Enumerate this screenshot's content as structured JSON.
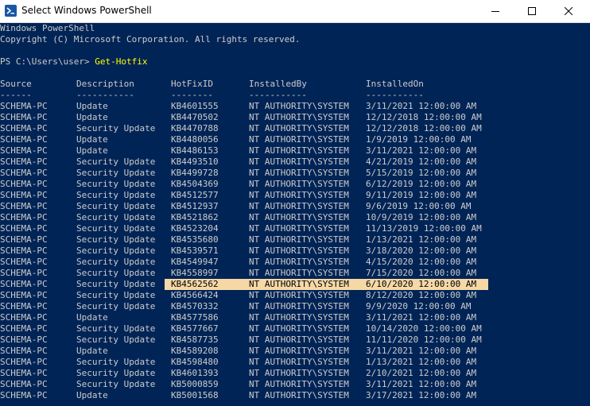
{
  "window": {
    "title": "Select Windows PowerShell"
  },
  "banner": {
    "line1": "Windows PowerShell",
    "line2": "Copyright (C) Microsoft Corporation. All rights reserved."
  },
  "prompt": {
    "text": "PS C:\\Users\\user> ",
    "command": "Get-Hotfix"
  },
  "table": {
    "headers": {
      "source": "Source",
      "description": "Description",
      "hotfixid": "HotFixID",
      "installedby": "InstalledBy",
      "installedon": "InstalledOn"
    },
    "dashes": {
      "source": "------",
      "description": "-----------",
      "hotfixid": "--------",
      "installedby": "-----------",
      "installedon": "-----------"
    },
    "rows": [
      {
        "source": "SCHEMA-PC",
        "description": "Update",
        "hotfixid": "KB4601555",
        "installedby": "NT AUTHORITY\\SYSTEM",
        "installedon": "3/11/2021 12:00:00 AM"
      },
      {
        "source": "SCHEMA-PC",
        "description": "Update",
        "hotfixid": "KB4470502",
        "installedby": "NT AUTHORITY\\SYSTEM",
        "installedon": "12/12/2018 12:00:00 AM"
      },
      {
        "source": "SCHEMA-PC",
        "description": "Security Update",
        "hotfixid": "KB4470788",
        "installedby": "NT AUTHORITY\\SYSTEM",
        "installedon": "12/12/2018 12:00:00 AM"
      },
      {
        "source": "SCHEMA-PC",
        "description": "Update",
        "hotfixid": "KB4480056",
        "installedby": "NT AUTHORITY\\SYSTEM",
        "installedon": "1/9/2019 12:00:00 AM"
      },
      {
        "source": "SCHEMA-PC",
        "description": "Update",
        "hotfixid": "KB4486153",
        "installedby": "NT AUTHORITY\\SYSTEM",
        "installedon": "3/11/2021 12:00:00 AM"
      },
      {
        "source": "SCHEMA-PC",
        "description": "Security Update",
        "hotfixid": "KB4493510",
        "installedby": "NT AUTHORITY\\SYSTEM",
        "installedon": "4/21/2019 12:00:00 AM"
      },
      {
        "source": "SCHEMA-PC",
        "description": "Security Update",
        "hotfixid": "KB4499728",
        "installedby": "NT AUTHORITY\\SYSTEM",
        "installedon": "5/15/2019 12:00:00 AM"
      },
      {
        "source": "SCHEMA-PC",
        "description": "Security Update",
        "hotfixid": "KB4504369",
        "installedby": "NT AUTHORITY\\SYSTEM",
        "installedon": "6/12/2019 12:00:00 AM"
      },
      {
        "source": "SCHEMA-PC",
        "description": "Security Update",
        "hotfixid": "KB4512577",
        "installedby": "NT AUTHORITY\\SYSTEM",
        "installedon": "9/11/2019 12:00:00 AM"
      },
      {
        "source": "SCHEMA-PC",
        "description": "Security Update",
        "hotfixid": "KB4512937",
        "installedby": "NT AUTHORITY\\SYSTEM",
        "installedon": "9/6/2019 12:00:00 AM"
      },
      {
        "source": "SCHEMA-PC",
        "description": "Security Update",
        "hotfixid": "KB4521862",
        "installedby": "NT AUTHORITY\\SYSTEM",
        "installedon": "10/9/2019 12:00:00 AM"
      },
      {
        "source": "SCHEMA-PC",
        "description": "Security Update",
        "hotfixid": "KB4523204",
        "installedby": "NT AUTHORITY\\SYSTEM",
        "installedon": "11/13/2019 12:00:00 AM"
      },
      {
        "source": "SCHEMA-PC",
        "description": "Security Update",
        "hotfixid": "KB4535680",
        "installedby": "NT AUTHORITY\\SYSTEM",
        "installedon": "1/13/2021 12:00:00 AM"
      },
      {
        "source": "SCHEMA-PC",
        "description": "Security Update",
        "hotfixid": "KB4539571",
        "installedby": "NT AUTHORITY\\SYSTEM",
        "installedon": "3/18/2020 12:00:00 AM"
      },
      {
        "source": "SCHEMA-PC",
        "description": "Security Update",
        "hotfixid": "KB4549947",
        "installedby": "NT AUTHORITY\\SYSTEM",
        "installedon": "4/15/2020 12:00:00 AM"
      },
      {
        "source": "SCHEMA-PC",
        "description": "Security Update",
        "hotfixid": "KB4558997",
        "installedby": "NT AUTHORITY\\SYSTEM",
        "installedon": "7/15/2020 12:00:00 AM"
      },
      {
        "source": "SCHEMA-PC",
        "description": "Security Update",
        "hotfixid": "KB4562562",
        "installedby": "NT AUTHORITY\\SYSTEM",
        "installedon": "6/10/2020 12:00:00 AM"
      },
      {
        "source": "SCHEMA-PC",
        "description": "Security Update",
        "hotfixid": "KB4566424",
        "installedby": "NT AUTHORITY\\SYSTEM",
        "installedon": "8/12/2020 12:00:00 AM"
      },
      {
        "source": "SCHEMA-PC",
        "description": "Security Update",
        "hotfixid": "KB4570332",
        "installedby": "NT AUTHORITY\\SYSTEM",
        "installedon": "9/9/2020 12:00:00 AM"
      },
      {
        "source": "SCHEMA-PC",
        "description": "Update",
        "hotfixid": "KB4577586",
        "installedby": "NT AUTHORITY\\SYSTEM",
        "installedon": "3/11/2021 12:00:00 AM"
      },
      {
        "source": "SCHEMA-PC",
        "description": "Security Update",
        "hotfixid": "KB4577667",
        "installedby": "NT AUTHORITY\\SYSTEM",
        "installedon": "10/14/2020 12:00:00 AM"
      },
      {
        "source": "SCHEMA-PC",
        "description": "Security Update",
        "hotfixid": "KB4587735",
        "installedby": "NT AUTHORITY\\SYSTEM",
        "installedon": "11/11/2020 12:00:00 AM"
      },
      {
        "source": "SCHEMA-PC",
        "description": "Update",
        "hotfixid": "KB4589208",
        "installedby": "NT AUTHORITY\\SYSTEM",
        "installedon": "3/11/2021 12:00:00 AM"
      },
      {
        "source": "SCHEMA-PC",
        "description": "Security Update",
        "hotfixid": "KB4598480",
        "installedby": "NT AUTHORITY\\SYSTEM",
        "installedon": "1/13/2021 12:00:00 AM"
      },
      {
        "source": "SCHEMA-PC",
        "description": "Security Update",
        "hotfixid": "KB4601393",
        "installedby": "NT AUTHORITY\\SYSTEM",
        "installedon": "2/10/2021 12:00:00 AM"
      },
      {
        "source": "SCHEMA-PC",
        "description": "Security Update",
        "hotfixid": "KB5000859",
        "installedby": "NT AUTHORITY\\SYSTEM",
        "installedon": "3/11/2021 12:00:00 AM"
      },
      {
        "source": "SCHEMA-PC",
        "description": "Update",
        "hotfixid": "KB5001568",
        "installedby": "NT AUTHORITY\\SYSTEM",
        "installedon": "3/17/2021 12:00:00 AM"
      }
    ]
  },
  "selection": {
    "row_index": 16
  },
  "colors": {
    "background": "#012456",
    "text": "#cccccc",
    "command": "#ffff00",
    "selection": "#f5d8a6"
  },
  "icons": {
    "app": "powershell-icon",
    "minimize": "minimize-icon",
    "maximize": "maximize-icon",
    "close": "close-icon"
  }
}
